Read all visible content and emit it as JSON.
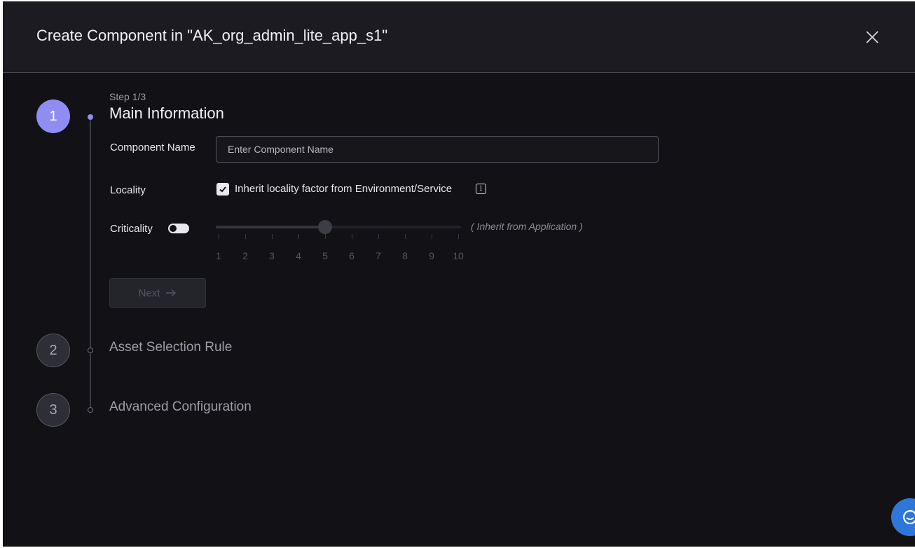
{
  "modal": {
    "title": "Create Component in \"AK_org_admin_lite_app_s1\""
  },
  "steps": [
    {
      "number": "1",
      "subtitle": "Step 1/3",
      "title": "Main Information",
      "state": "active"
    },
    {
      "number": "2",
      "title": "Asset Selection Rule",
      "state": "inactive"
    },
    {
      "number": "3",
      "title": "Advanced Configuration",
      "state": "inactive"
    }
  ],
  "form": {
    "component_name": {
      "label": "Component Name",
      "placeholder": "Enter Component Name",
      "value": ""
    },
    "locality": {
      "label": "Locality",
      "checkbox_label": "Inherit locality factor from Environment/Service",
      "checked": true,
      "info_icon": "info-icon"
    },
    "criticality": {
      "label": "Criticality",
      "toggle_on": false,
      "value": 5,
      "min": 1,
      "max": 10,
      "ticks": [
        "1",
        "2",
        "3",
        "4",
        "5",
        "6",
        "7",
        "8",
        "9",
        "10"
      ],
      "inherit_text": "( Inherit from Application )"
    },
    "next_button": {
      "label": "Next",
      "icon": "arrow-right-icon",
      "disabled": true
    }
  },
  "icons": {
    "close": "close-icon",
    "chat": "chat-icon"
  },
  "colors": {
    "accent": "#8f8cf2",
    "background": "#121216",
    "header": "#1b1b21",
    "chat_button": "#2f76d9"
  }
}
